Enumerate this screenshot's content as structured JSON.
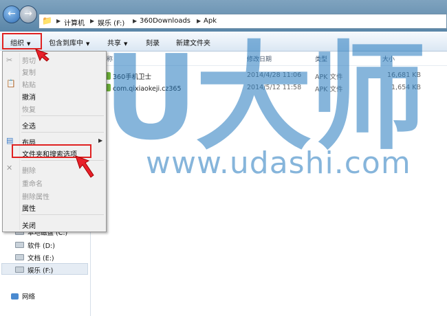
{
  "address_bar": {
    "crumbs": [
      "计算机",
      "娱乐 (F:)",
      "360Downloads",
      "Apk"
    ]
  },
  "toolbar": {
    "organize": "组织",
    "include_in_library": "包含到库中",
    "share": "共享",
    "burn": "刻录",
    "new_folder": "新建文件夹"
  },
  "columns": [
    "名称",
    "修改日期",
    "类型",
    "大小"
  ],
  "files": [
    {
      "name": "360手机卫士",
      "modified": "2014/4/28 11:06",
      "type": "APK 文件",
      "size": "16,681 KB"
    },
    {
      "name": "com.qixiaokeji.cz365",
      "modified": "2014/5/12 11:58",
      "type": "APK 文件",
      "size": "1,654 KB"
    }
  ],
  "menu": {
    "cut": "剪切",
    "copy": "复制",
    "paste": "粘贴",
    "undo": "撤消",
    "redo": "恢复",
    "select_all": "全选",
    "layout": "布局",
    "folder_options": "文件夹和搜索选项",
    "delete": "删除",
    "rename": "重命名",
    "remove_properties": "删除属性",
    "properties": "属性",
    "close": "关闭"
  },
  "nav": {
    "local_disk_c": "本地磁盘 (C:)",
    "drive_d": "软件 (D:)",
    "drive_e": "文档 (E:)",
    "drive_f": "娱乐 (F:)",
    "network": "网络"
  },
  "watermark": {
    "logo": "U大师",
    "url": "www.udashi.com"
  },
  "colors": {
    "highlight": "#e02020",
    "watermark": "#2378be"
  }
}
